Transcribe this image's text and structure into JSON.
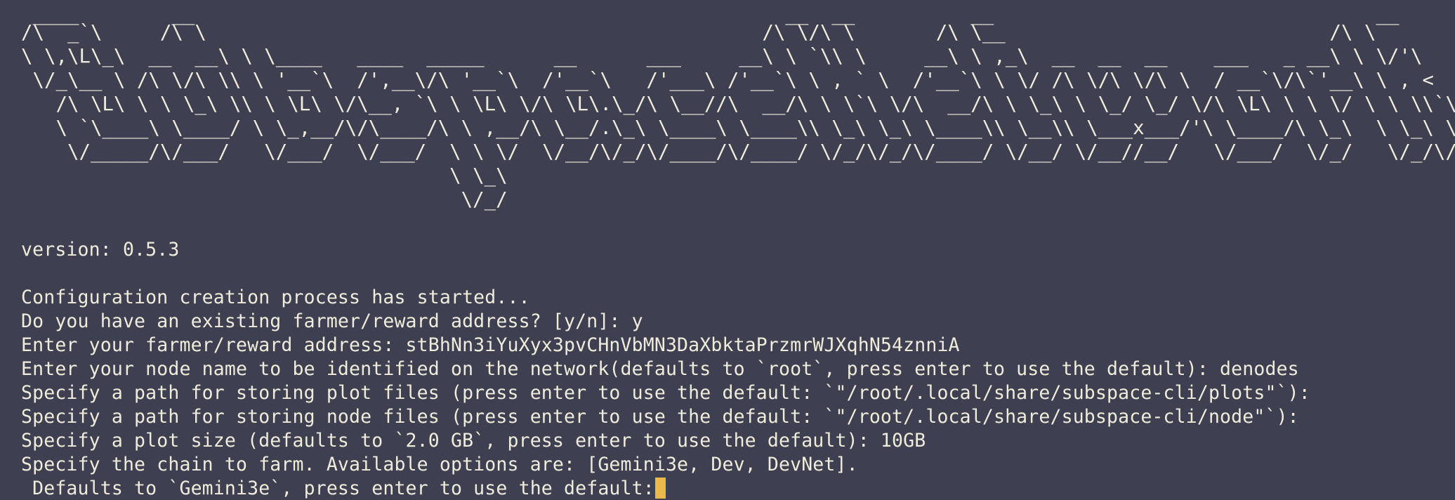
{
  "theme": {
    "background": "#3e3f50",
    "foreground": "#f0ecdc",
    "cursor_color": "#e8b94a"
  },
  "banner": {
    "lines": [
      " ____        __                                                   __  __          __                                 __",
      "/\\  _`\\     /\\ \\                                                /\\ \\/\\ \\       /\\ \\__                            /\\ \\",
      "\\ \\,\\L\\_\\  __  __\\ \\ \\____   ____  _____      __      ___     __\\ \\ `\\\\ \\     __\\ \\ ,_\\  __  __  __    ___   _ __\\ \\ \\/'\\",
      " \\/_\\__ \\ /\\ \\/\\ \\\\ \\ '__`\\  /',__\\/\\ '__`\\  /'__`\\   /'___\\ /'__`\\ \\ , ` \\  /'__`\\ \\ \\/ /\\ \\/\\ \\/\\ \\  / __`\\/\\`'__\\ \\ , <",
      "   /\\ \\L\\ \\ \\ \\_\\ \\\\ \\ \\L\\ \\/\\__, `\\ \\ \\L\\ \\/\\ \\L\\.\\_/\\ \\__//\\  __/\\ \\ \\`\\ \\/\\  __/\\ \\ \\_\\ \\ \\_/ \\_/ \\/\\ \\L\\ \\ \\ \\/ \\ \\ \\\\`\\",
      "   \\ `\\____\\ \\____/ \\ \\_,__/\\/\\____/\\ \\ ,__/\\ \\__/.\\_\\ \\____\\ \\____\\\\ \\_\\ \\_\\ \\____\\\\ \\__\\\\ \\___x___/'\\ \\____/\\ \\_\\  \\ \\_\\ \\_\\",
      "    \\/_____/\\/___/   \\/___/  \\/___/  \\ \\ \\/  \\/__/\\/_/\\/____/\\/____/ \\/_/\\/_/\\/____/ \\/__/ \\/__//__/   \\/___/  \\/_/   \\/_/\\/_/",
      "                                     \\ \\_\\",
      "                                      \\/_/"
    ]
  },
  "output": {
    "version": "version: 0.5.3",
    "lines": [
      "Configuration creation process has started...",
      "Do you have an existing farmer/reward address? [y/n]: y",
      "Enter your farmer/reward address: stBhNn3iYuXyx3pvCHnVbMN3DaXbktaPrzmrWJXqhN54znniA",
      "Enter your node name to be identified on the network(defaults to `root`, press enter to use the default): denodes",
      "Specify a path for storing plot files (press enter to use the default: `\"/root/.local/share/subspace-cli/plots\"`):",
      "Specify a path for storing node files (press enter to use the default: `\"/root/.local/share/subspace-cli/node\"`):",
      "Specify a plot size (defaults to `2.0 GB`, press enter to use the default): 10GB",
      "Specify the chain to farm. Available options are: [Gemini3e, Dev, DevNet]."
    ],
    "prompt": " Defaults to `Gemini3e`, press enter to use the default:"
  }
}
